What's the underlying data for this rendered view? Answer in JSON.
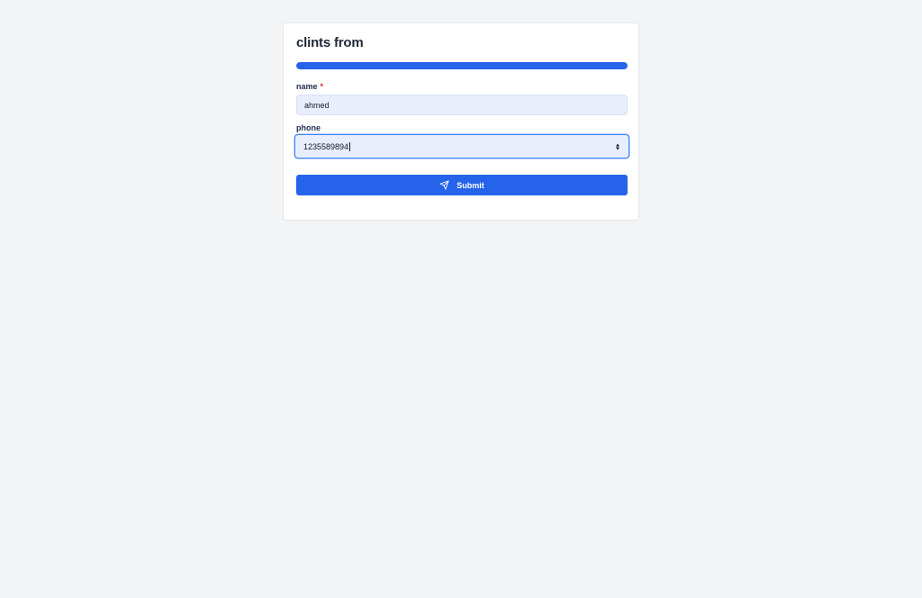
{
  "form": {
    "title": "clints from",
    "progress": 1.0,
    "fields": {
      "name": {
        "label": "name",
        "required_marker": "*",
        "value": "ahmed"
      },
      "phone": {
        "label": "phone",
        "value": "1235589894"
      }
    },
    "submit": {
      "label": "Submit",
      "icon": "send-icon"
    }
  },
  "colors": {
    "accent": "#2563eb",
    "required": "#dc2626",
    "page_background": "#f3f4f6",
    "field_background": "#e8eefc"
  }
}
